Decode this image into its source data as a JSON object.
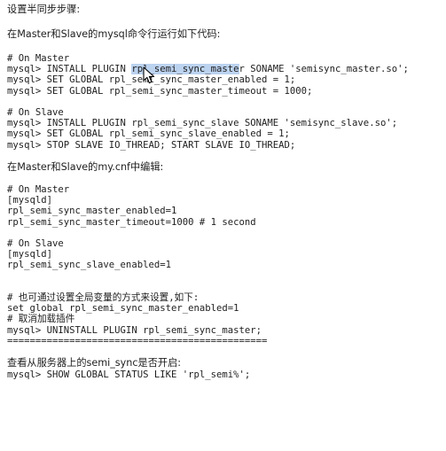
{
  "doc": {
    "heading": "设置半同步步骤:",
    "intro": "在Master和Slave的mysql命令行运行如下代码:",
    "master_block": {
      "comment": "# On Master",
      "line1_prefix": "mysql> INSTALL PLUGIN ",
      "line1_selected": "rpl_semi_sync_maste",
      "line1_suffix": "r SONAME 'semisync_master.so';",
      "line2": "mysql> SET GLOBAL rpl_semi_sync_master_enabled = 1;",
      "line3": "mysql> SET GLOBAL rpl_semi_sync_master_timeout = 1000;"
    },
    "slave_block": {
      "comment": "# On Slave",
      "line1": "mysql> INSTALL PLUGIN rpl_semi_sync_slave SONAME 'semisync_slave.so';",
      "line2": "mysql> SET GLOBAL rpl_semi_sync_slave_enabled = 1;",
      "line3": "mysql> STOP SLAVE IO_THREAD; START SLAVE IO_THREAD;"
    },
    "cnf_intro": "在Master和Slave的my.cnf中编辑:",
    "cnf_master": {
      "comment": "# On Master",
      "section": "[mysqld]",
      "line1": "rpl_semi_sync_master_enabled=1",
      "line2": "rpl_semi_sync_master_timeout=1000 # 1 second"
    },
    "cnf_slave": {
      "comment": "# On Slave",
      "section": "[mysqld]",
      "line1": "rpl_semi_sync_slave_enabled=1"
    },
    "global_block": {
      "comment": "# 也可通过设置全局变量的方式来设置,如下:",
      "line1": "set global rpl_semi_sync_master_enabled=1",
      "comment2": "# 取消加载插件",
      "line2": "mysql> UNINSTALL PLUGIN rpl_semi_sync_master;",
      "separator": "=============================================="
    },
    "check_intro": "查看从服务器上的semi_sync是否开启:",
    "check_line": "mysql> SHOW GLOBAL STATUS LIKE 'rpl_semi%';"
  }
}
